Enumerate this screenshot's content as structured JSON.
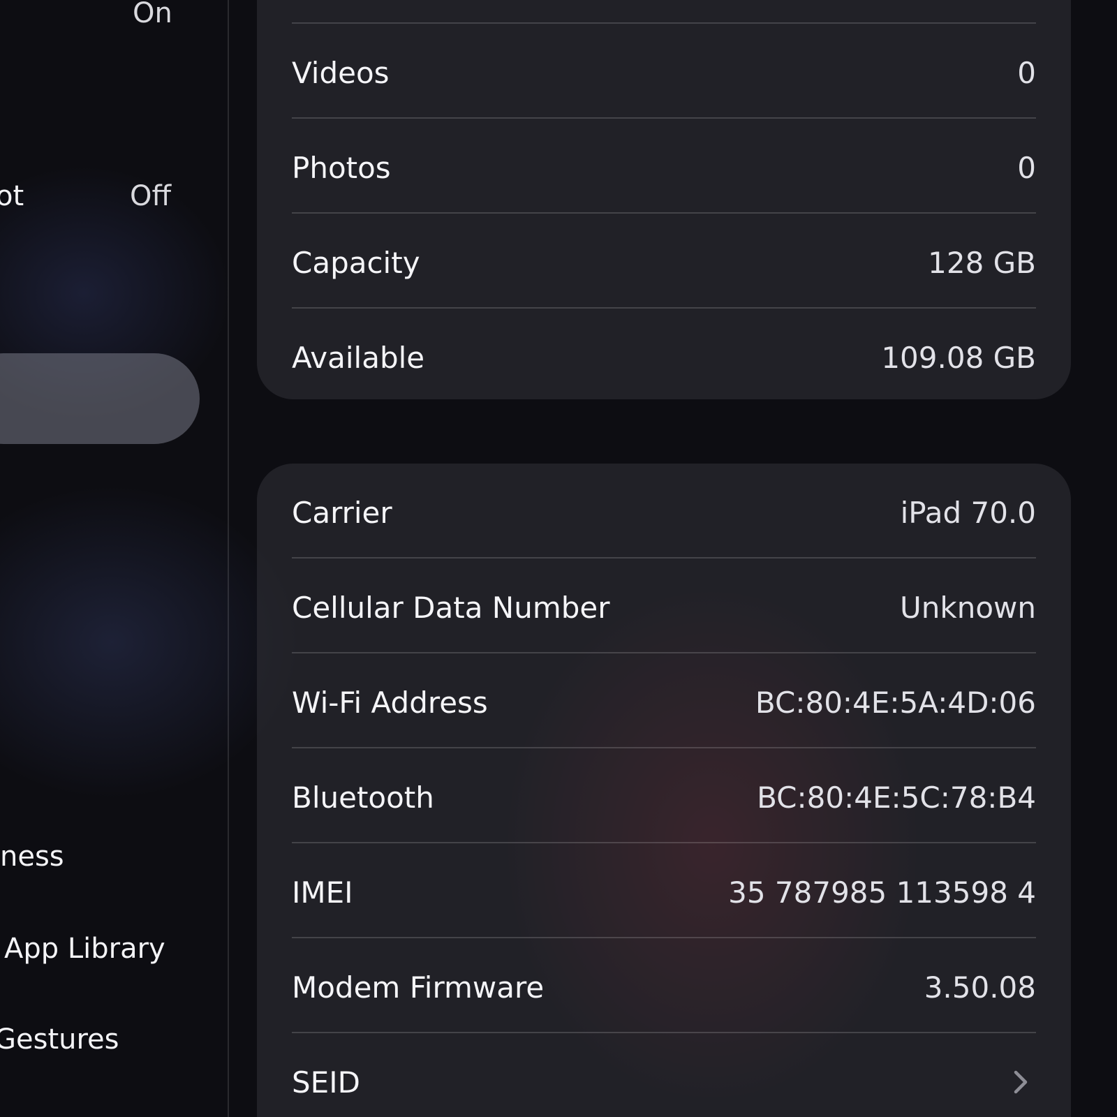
{
  "sidebar": {
    "items": [
      {
        "label": "",
        "value": "On"
      },
      {
        "label": "ot",
        "value": "Off"
      },
      {
        "label": "ness",
        "value": ""
      },
      {
        "label": "App Library",
        "value": ""
      },
      {
        "label": "Gestures",
        "value": ""
      }
    ]
  },
  "storage": {
    "rows": [
      {
        "label": "Videos",
        "value": "0"
      },
      {
        "label": "Photos",
        "value": "0"
      },
      {
        "label": "Capacity",
        "value": "128 GB"
      },
      {
        "label": "Available",
        "value": "109.08 GB"
      }
    ]
  },
  "network": {
    "rows": [
      {
        "label": "Carrier",
        "value": "iPad 70.0"
      },
      {
        "label": "Cellular Data Number",
        "value": "Unknown"
      },
      {
        "label": "Wi-Fi Address",
        "value": "BC:80:4E:5A:4D:06"
      },
      {
        "label": "Bluetooth",
        "value": "BC:80:4E:5C:78:B4"
      },
      {
        "label": "IMEI",
        "value": "35 787985 113598 4"
      },
      {
        "label": "Modem Firmware",
        "value": "3.50.08"
      },
      {
        "label": "SEID",
        "value": ""
      }
    ],
    "seid_icon": "chevron-right-icon"
  }
}
